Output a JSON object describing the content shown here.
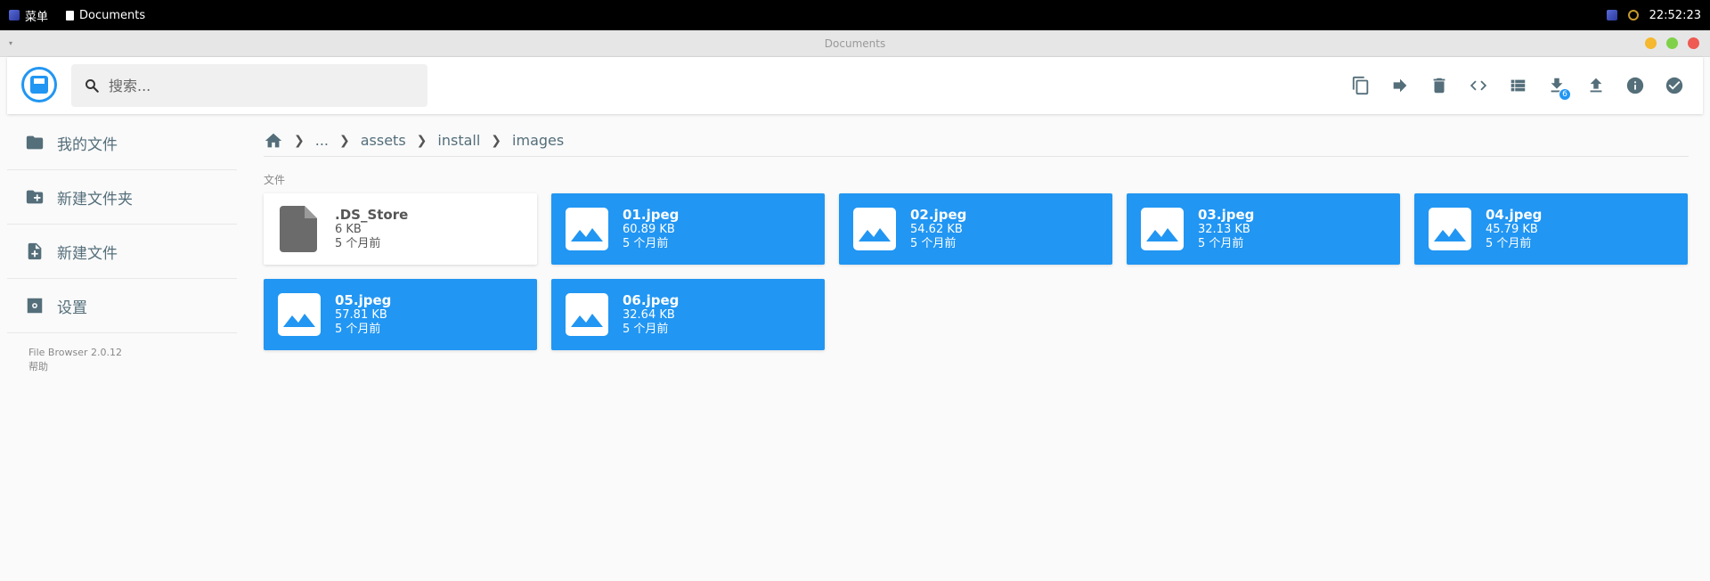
{
  "taskbar": {
    "menu_label": "菜单",
    "window_label": "Documents",
    "clock": "22:52:23"
  },
  "window": {
    "title": "Documents"
  },
  "header": {
    "search_placeholder": "搜索...",
    "download_badge": "6"
  },
  "toolbar": {
    "icons": [
      "copy-icon",
      "move-icon",
      "delete-icon",
      "code-icon",
      "list-view-icon",
      "download-icon",
      "upload-icon",
      "info-icon",
      "check-circle-icon"
    ]
  },
  "sidebar": {
    "items": [
      {
        "label": "我的文件",
        "icon": "folder-icon"
      },
      {
        "label": "新建文件夹",
        "icon": "new-folder-icon"
      },
      {
        "label": "新建文件",
        "icon": "new-file-icon"
      },
      {
        "label": "设置",
        "icon": "settings-icon"
      }
    ],
    "footer_version": "File Browser 2.0.12",
    "footer_help": "帮助"
  },
  "breadcrumb": {
    "ellipsis": "...",
    "parts": [
      "assets",
      "install",
      "images"
    ]
  },
  "section_label": "文件",
  "files": [
    {
      "name": ".DS_Store",
      "size": "6 KB",
      "modified": "5 个月前",
      "type": "document",
      "selected": false
    },
    {
      "name": "01.jpeg",
      "size": "60.89 KB",
      "modified": "5 个月前",
      "type": "image",
      "selected": true
    },
    {
      "name": "02.jpeg",
      "size": "54.62 KB",
      "modified": "5 个月前",
      "type": "image",
      "selected": true
    },
    {
      "name": "03.jpeg",
      "size": "32.13 KB",
      "modified": "5 个月前",
      "type": "image",
      "selected": true
    },
    {
      "name": "04.jpeg",
      "size": "45.79 KB",
      "modified": "5 个月前",
      "type": "image",
      "selected": true
    },
    {
      "name": "05.jpeg",
      "size": "57.81 KB",
      "modified": "5 个月前",
      "type": "image",
      "selected": true
    },
    {
      "name": "06.jpeg",
      "size": "32.64 KB",
      "modified": "5 个月前",
      "type": "image",
      "selected": true
    }
  ],
  "colors": {
    "accent": "#2196f3",
    "icon_gray": "#546e7a",
    "taskbar": "#000000"
  }
}
